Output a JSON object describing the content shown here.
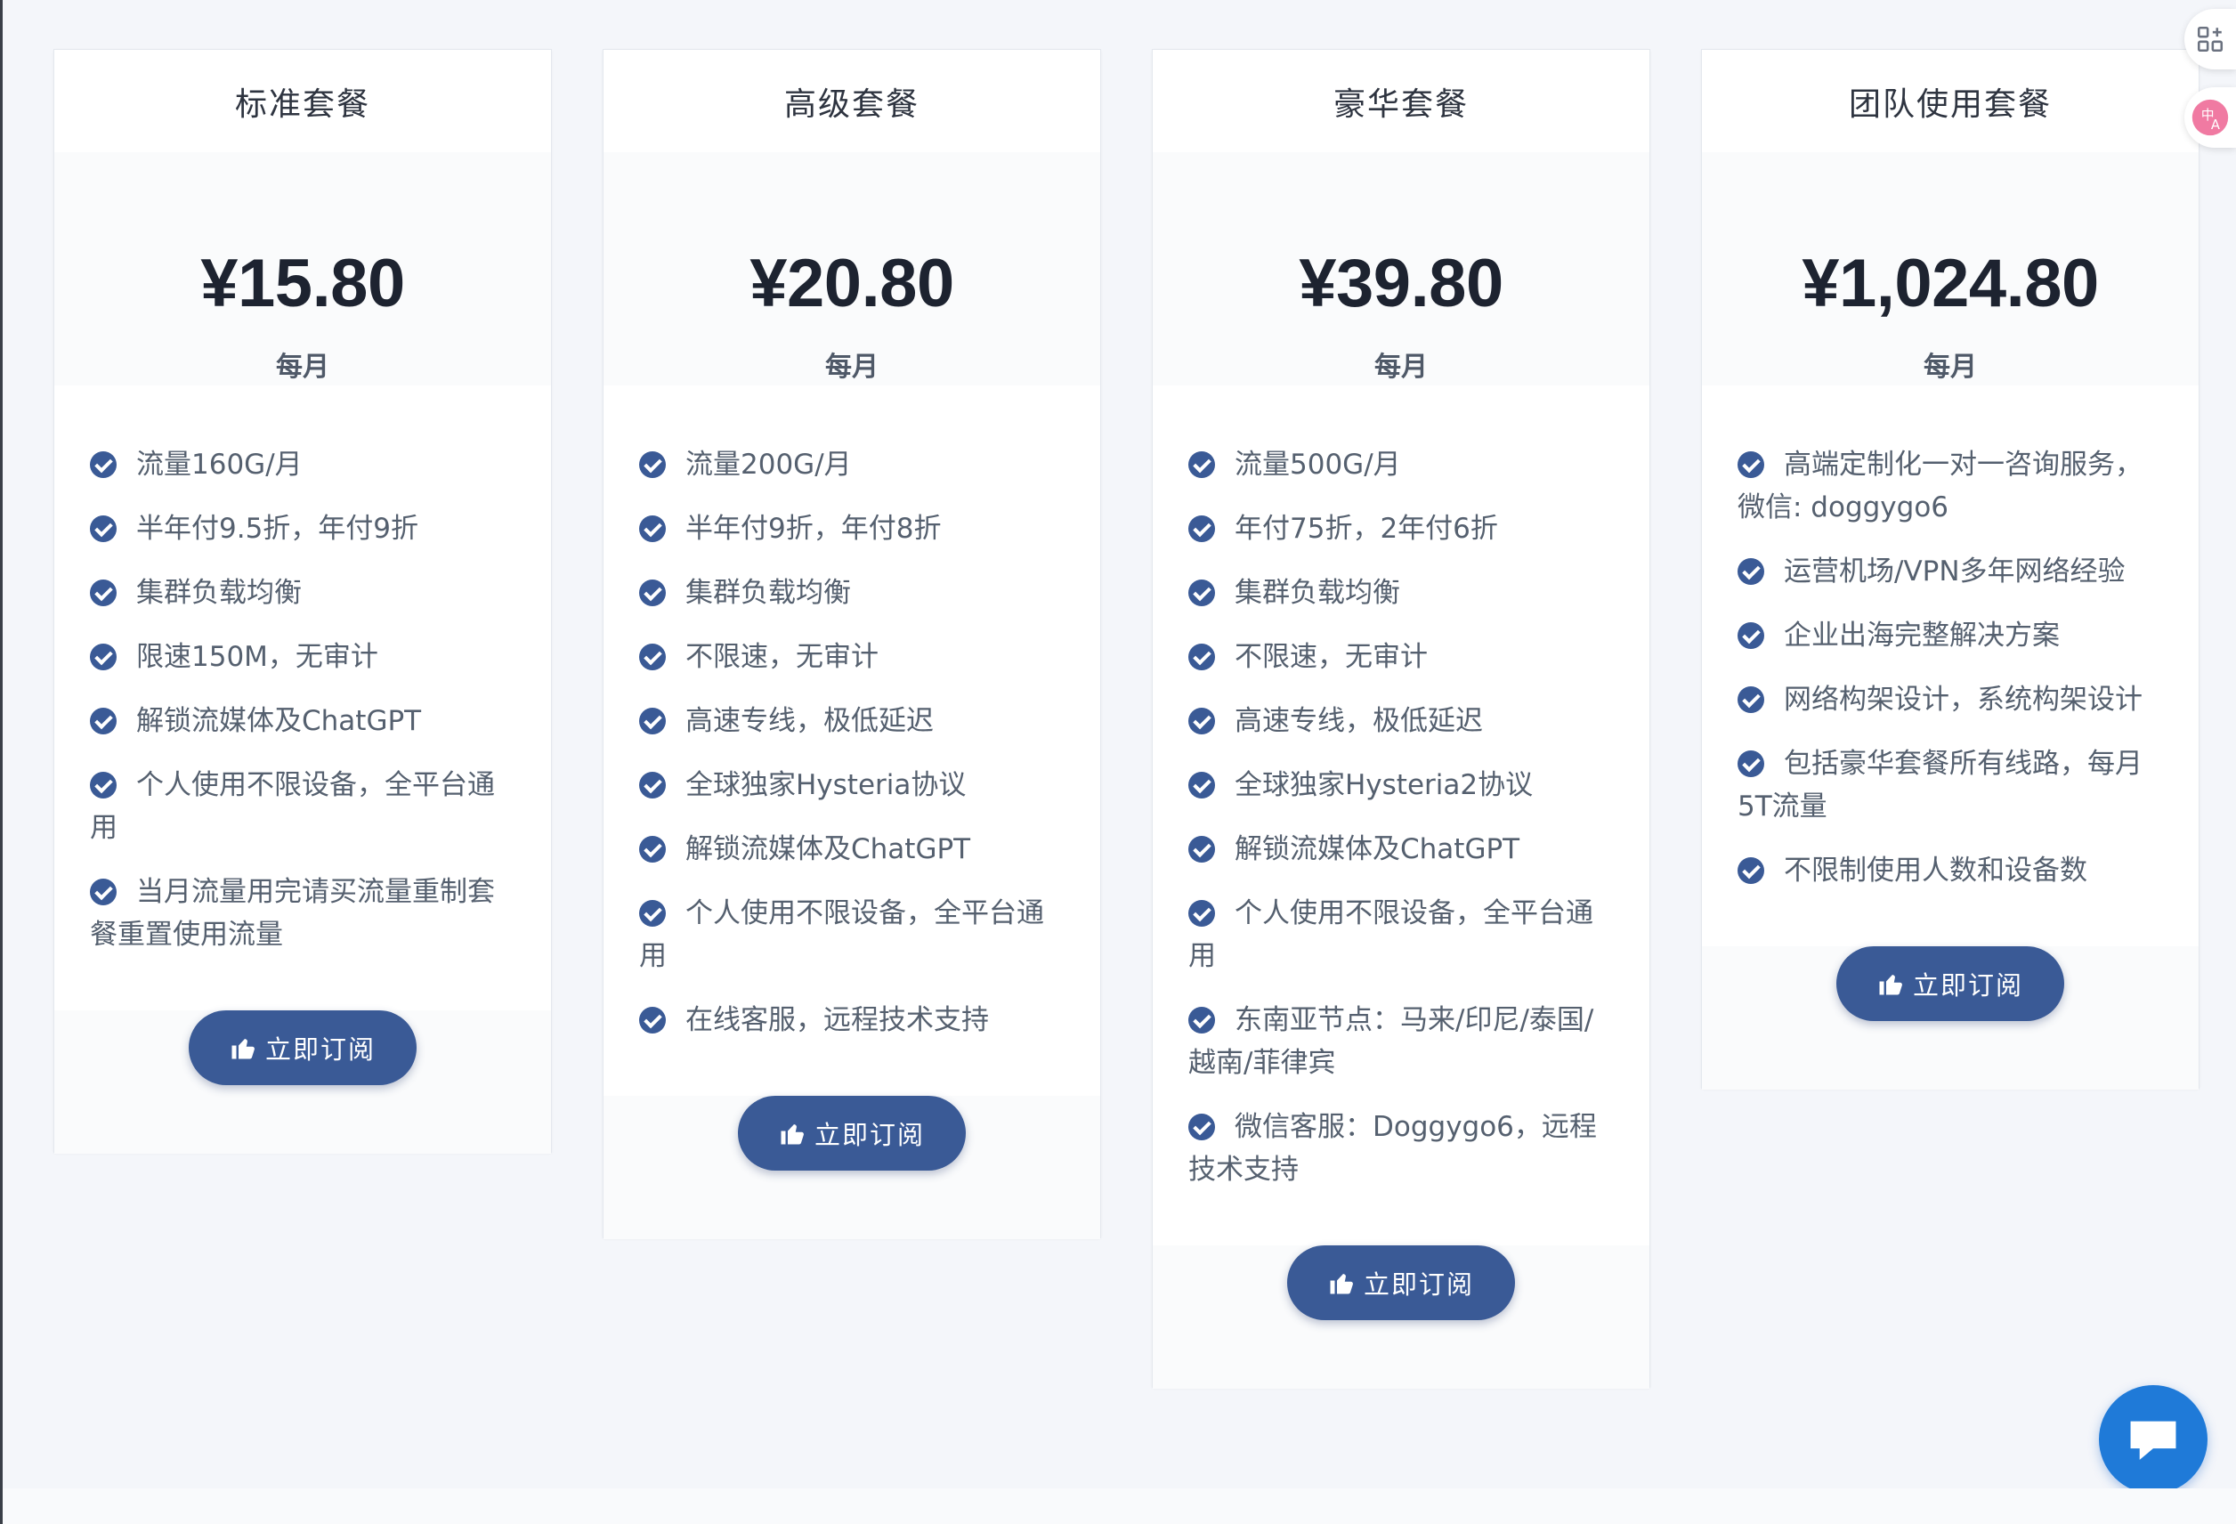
{
  "plans": [
    {
      "title": "标准套餐",
      "price": "¥15.80",
      "period": "每月",
      "features": [
        "流量160G/月",
        "半年付9.5折，年付9折",
        "集群负载均衡",
        "限速150M，无审计",
        "解锁流媒体及ChatGPT",
        "个人使用不限设备，全平台通用",
        "当月流量用完请买流量重制套餐重置使用流量"
      ],
      "button": "立即订阅"
    },
    {
      "title": "高级套餐",
      "price": "¥20.80",
      "period": "每月",
      "features": [
        "流量200G/月",
        "半年付9折，年付8折",
        "集群负载均衡",
        "不限速，无审计",
        "高速专线，极低延迟",
        "全球独家Hysteria协议",
        "解锁流媒体及ChatGPT",
        "个人使用不限设备，全平台通用",
        "在线客服，远程技术支持"
      ],
      "button": "立即订阅"
    },
    {
      "title": "豪华套餐",
      "price": "¥39.80",
      "period": "每月",
      "features": [
        "流量500G/月",
        "年付75折，2年付6折",
        "集群负载均衡",
        "不限速，无审计",
        "高速专线，极低延迟",
        "全球独家Hysteria2协议",
        "解锁流媒体及ChatGPT",
        "个人使用不限设备，全平台通用",
        "东南亚节点：马来/印尼/泰国/越南/菲律宾",
        "微信客服：Doggygo6，远程技术支持"
      ],
      "button": "立即订阅"
    },
    {
      "title": "团队使用套餐",
      "price": "¥1,024.80",
      "period": "每月",
      "features": [
        "高端定制化一对一咨询服务，微信: doggygo6",
        "运营机场/VPN多年网络经验",
        "企业出海完整解决方案",
        "网络构架设计，系统构架设计",
        "包括豪华套餐所有线路，每月5T流量",
        "不限制使用人数和设备数"
      ],
      "button": "立即订阅"
    }
  ],
  "colors": {
    "accent": "#3a5a96",
    "chat_button": "#1f7ad8",
    "page_background": "#f4f6fa"
  },
  "icons": {
    "feature": "check-circle-icon",
    "button": "thumbs-up-icon",
    "side_top": "qr-grid-icon",
    "side_bottom": "translate-icon",
    "chat": "chat-bubble-icon"
  }
}
